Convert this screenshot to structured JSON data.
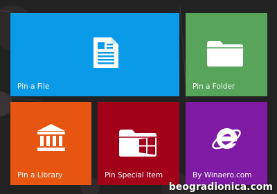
{
  "tiles": [
    {
      "name": "tile-pin-file",
      "label": "Pin a File",
      "color": "#0a9be8",
      "icon": "document-icon"
    },
    {
      "name": "tile-pin-folder",
      "label": "Pin a Folder",
      "color": "#57a45a",
      "icon": "folder-icon"
    },
    {
      "name": "tile-pin-library",
      "label": "Pin a Library",
      "color": "#e85510",
      "icon": "library-icon"
    },
    {
      "name": "tile-pin-special-item",
      "label": "Pin Special Item",
      "color": "#a3001a",
      "icon": "windows-folder-icon"
    },
    {
      "name": "tile-by-winaero",
      "label": "By Winaero.com",
      "color": "#7e1aa3",
      "icon": "internet-explorer-icon"
    }
  ],
  "watermark": "beogradionica.com"
}
